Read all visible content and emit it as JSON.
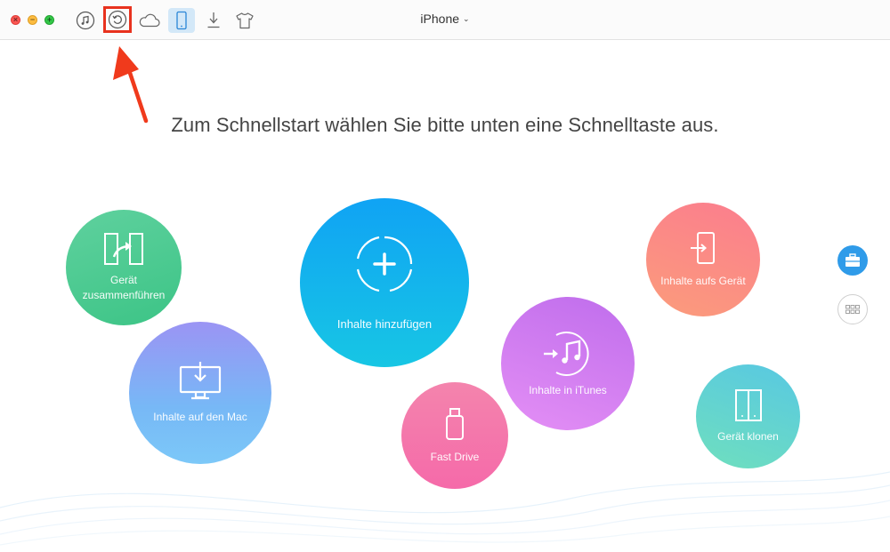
{
  "window": {
    "close_glyph": "×",
    "minimize_glyph": "−",
    "zoom_glyph": "+"
  },
  "toolbar": {
    "icons": [
      {
        "name": "music-icon",
        "active": false
      },
      {
        "name": "backup-restore-icon",
        "active": false,
        "highlighted": true
      },
      {
        "name": "cloud-icon",
        "active": false
      },
      {
        "name": "phone-icon",
        "active": true
      },
      {
        "name": "download-icon",
        "active": false
      },
      {
        "name": "tshirt-icon",
        "active": false
      }
    ],
    "device_name": "iPhone",
    "device_chevron": "⌄",
    "highlight_color": "#e8321e"
  },
  "main": {
    "headline": "Zum Schnellstart wählen Sie bitte unten eine Schnelltaste aus."
  },
  "quick_actions": {
    "merge": {
      "label_line1": "Gerät",
      "label_line2": "zusammenführen",
      "icon": "merge-icon"
    },
    "mac": {
      "label": "Inhalte auf den Mac",
      "icon": "monitor-download-icon"
    },
    "add": {
      "label": "Inhalte hinzufügen",
      "icon": "plus-circle-icon"
    },
    "fast_drive": {
      "label": "Fast Drive",
      "icon": "usb-drive-icon"
    },
    "itunes": {
      "label": "Inhalte in iTunes",
      "icon": "itunes-icon"
    },
    "to_device": {
      "label": "Inhalte aufs Gerät",
      "icon": "phone-import-icon"
    },
    "clone": {
      "label": "Gerät klonen",
      "icon": "clone-icon"
    }
  },
  "side_panel": {
    "buttons": [
      {
        "name": "toolbox-icon",
        "active": true
      },
      {
        "name": "grid-icon",
        "active": false
      }
    ]
  },
  "colors": {
    "accent_blue": "#2f9be9",
    "arrow_red": "#f03a1c"
  }
}
